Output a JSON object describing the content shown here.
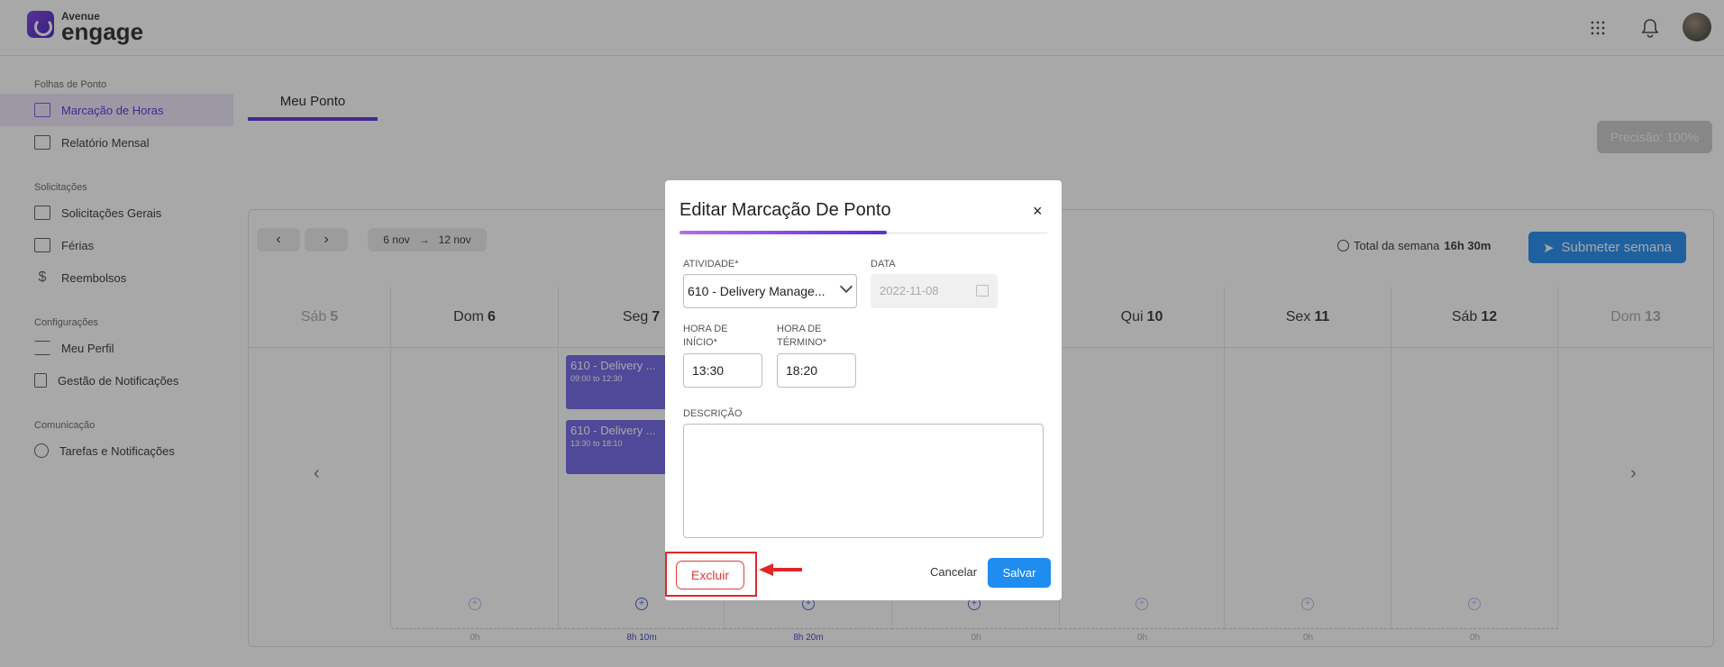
{
  "brand": {
    "small": "Avenue",
    "big": "engage"
  },
  "sidebar": {
    "sections": [
      {
        "title": "Folhas de Ponto"
      },
      {
        "title": "Solicitações"
      },
      {
        "title": "Configurações"
      },
      {
        "title": "Comunicação"
      }
    ],
    "items": [
      {
        "label": "Marcação de Horas"
      },
      {
        "label": "Relatório Mensal"
      },
      {
        "label": "Solicitações Gerais"
      },
      {
        "label": "Férias"
      },
      {
        "label": "Reembolsos"
      },
      {
        "label": "Meu Perfil"
      },
      {
        "label": "Gestão de Notificações"
      },
      {
        "label": "Tarefas e Notificações"
      }
    ]
  },
  "main": {
    "tab": "Meu Ponto",
    "precisao": "Precisão: 100%",
    "range_start": "6 nov",
    "range_end": "12 nov",
    "total_label": "Total da semana",
    "total_value": "16h 30m",
    "submit_label": "Submeter semana"
  },
  "days": [
    {
      "name": "Sáb",
      "num": "5"
    },
    {
      "name": "Dom",
      "num": "6"
    },
    {
      "name": "Seg",
      "num": "7"
    },
    {
      "name": "Qui",
      "num": "10"
    },
    {
      "name": "Sex",
      "num": "11"
    },
    {
      "name": "Sáb",
      "num": "12"
    },
    {
      "name": "Dom",
      "num": "13"
    }
  ],
  "events": [
    {
      "title": "610 - Delivery ...",
      "time": "09:00 to 12:30"
    },
    {
      "title": "610 - Delivery ...",
      "time": "13:30 to 18:10"
    }
  ],
  "day_totals": [
    "0h",
    "8h 10m",
    "8h 20m",
    "0h",
    "0h",
    "0h",
    "0h"
  ],
  "modal": {
    "title": "Editar Marcação De Ponto",
    "close": "×",
    "activity_label": "ATIVIDADE*",
    "activity_value": "610 - Delivery Manage...",
    "date_label": "DATA",
    "date_value": "2022-11-08",
    "start_label": "HORA DE INÍCIO*",
    "start_value": "13:30",
    "end_label": "HORA DE TÉRMINO*",
    "end_value": "18:20",
    "desc_label": "DESCRIÇÃO",
    "delete_label": "Excluir",
    "cancel_label": "Cancelar",
    "save_label": "Salvar"
  },
  "colors": {
    "accent": "#5b2fd6",
    "primary": "#1f8cf0",
    "danger": "#e53935"
  }
}
